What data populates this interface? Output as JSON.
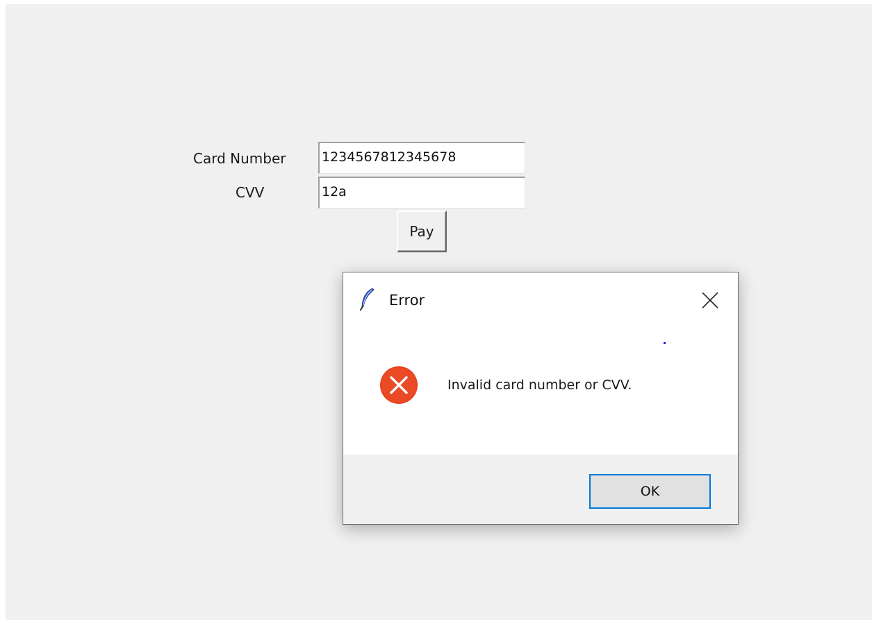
{
  "form": {
    "card_number_label": "Card Number",
    "card_number_value": "1234567812345678",
    "cvv_label": "CVV",
    "cvv_value": "12a",
    "pay_label": "Pay"
  },
  "dialog": {
    "title": "Error",
    "message": "Invalid card number or CVV.",
    "ok_label": "OK",
    "icons": {
      "title": "feather-icon",
      "close": "close-icon",
      "status": "error-icon"
    },
    "colors": {
      "error_red": "#e8411f",
      "focus_blue": "#0078d7"
    }
  }
}
